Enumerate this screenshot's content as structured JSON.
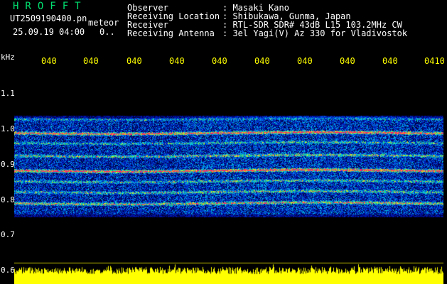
{
  "header": {
    "brand": "HROFFT",
    "filename": "UT2509190400.pn",
    "meteor_label": "meteor",
    "datetime": "25.09.19 04:00",
    "count": "0.."
  },
  "station": {
    "rows": [
      {
        "key": "Observer",
        "value": ": Masaki Kano"
      },
      {
        "key": "Receiving Location",
        "value": ": Shibukawa, Gunma, Japan"
      },
      {
        "key": "Receiver",
        "value": ": RTL-SDR SDR# 43dB L15 103.2MHz CW"
      },
      {
        "key": "Receiving Antenna",
        "value": ": 3el Yagi(V) Az 330 for Vladivostok"
      }
    ]
  },
  "time_axis": {
    "labels": [
      "040",
      "040",
      "040",
      "040",
      "040",
      "040",
      "040",
      "040",
      "040",
      "0410"
    ]
  },
  "freq_axis": {
    "unit": "kHz",
    "labels": [
      "1.1",
      "1.0",
      "0.9",
      "0.8",
      "0.7",
      "0.6"
    ]
  },
  "colors": {
    "text": "#ffffff",
    "brand": "#00e070",
    "axis_labels": "#ffff00",
    "strong_signal": "#ff2060",
    "noise_floor": "#0030c0"
  }
}
